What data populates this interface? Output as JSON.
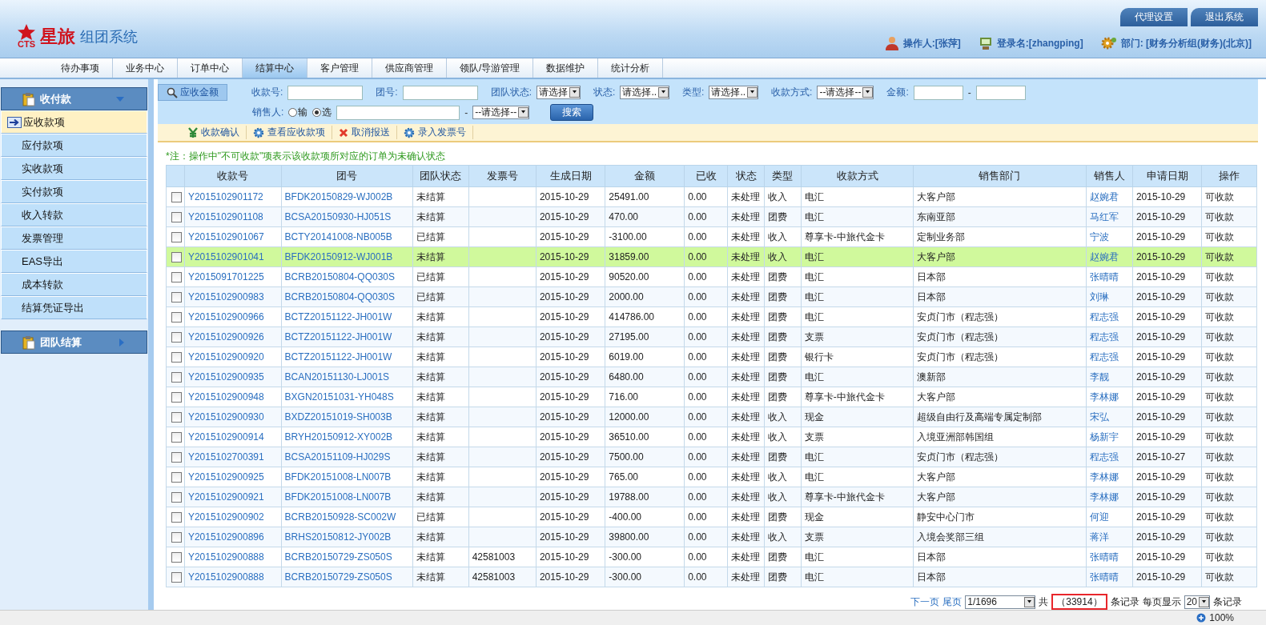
{
  "header": {
    "logo_mark": "CTS",
    "brand": "星旅",
    "system": "组团系统",
    "top_buttons": [
      "代理设置",
      "退出系统"
    ],
    "user_info": [
      {
        "kind": "person",
        "text": "操作人:[张萍]"
      },
      {
        "kind": "login",
        "text": "登录名:[zhangping]"
      },
      {
        "kind": "department",
        "text": "部门: [财务分析组(财务)(北京)]"
      }
    ]
  },
  "nav_tabs": [
    {
      "label": "待办事项",
      "selected": false
    },
    {
      "label": "业务中心",
      "selected": false
    },
    {
      "label": "订单中心",
      "selected": false
    },
    {
      "label": "结算中心",
      "selected": true
    },
    {
      "label": "客户管理",
      "selected": false
    },
    {
      "label": "供应商管理",
      "selected": false
    },
    {
      "label": "领队/导游管理",
      "selected": false
    },
    {
      "label": "数据维护",
      "selected": false
    },
    {
      "label": "统计分析",
      "selected": false
    }
  ],
  "sidebar": {
    "groups": [
      {
        "title": "收付款",
        "expanded": true,
        "items": [
          {
            "label": "应收款项",
            "selected": true
          },
          {
            "label": "应付款项",
            "selected": false
          },
          {
            "label": "实收款项",
            "selected": false
          },
          {
            "label": "实付款项",
            "selected": false
          },
          {
            "label": "收入转款",
            "selected": false
          },
          {
            "label": "发票管理",
            "selected": false
          },
          {
            "label": "EAS导出",
            "selected": false
          },
          {
            "label": "成本转款",
            "selected": false
          },
          {
            "label": "结算凭证导出",
            "selected": false
          }
        ]
      },
      {
        "title": "团队结算",
        "expanded": false
      }
    ]
  },
  "search": {
    "button": "应收金额",
    "fields": [
      {
        "kind": "text",
        "label": "收款号:"
      },
      {
        "kind": "text",
        "label": "团号:"
      },
      {
        "kind": "select",
        "label": "团队状态:",
        "value": "请选择"
      },
      {
        "kind": "select",
        "label": "状态:",
        "value": "请选择.."
      },
      {
        "kind": "select",
        "label": "类型:",
        "value": "请选择.."
      },
      {
        "kind": "select",
        "label": "收款方式:",
        "value": "--请选择--"
      },
      {
        "kind": "range",
        "label": "金额:",
        "separator": "-"
      }
    ],
    "salesperson": {
      "label": "销售人:",
      "options": [
        {
          "label": "输",
          "selected": false
        },
        {
          "label": "选",
          "selected": true
        }
      ],
      "separator": "-",
      "select": "--请选择--"
    },
    "submit": "搜索"
  },
  "toolbar": [
    {
      "kind": "confirm",
      "label": "收款确认"
    },
    {
      "kind": "view",
      "label": "查看应收款项"
    },
    {
      "kind": "cancel",
      "label": "取消报送"
    },
    {
      "kind": "invoice",
      "label": "录入发票号"
    }
  ],
  "note": "*注：操作中\"不可收款\"项表示该收款项所对应的订单为未确认状态",
  "table": {
    "columns": [
      {
        "label": "收款号",
        "kind": "link"
      },
      {
        "label": "团号",
        "kind": "link"
      },
      {
        "label": "团队状态",
        "kind": "text"
      },
      {
        "label": "发票号",
        "kind": "text"
      },
      {
        "label": "生成日期",
        "kind": "text"
      },
      {
        "label": "金额",
        "kind": "text"
      },
      {
        "label": "已收",
        "kind": "text"
      },
      {
        "label": "状态",
        "kind": "text"
      },
      {
        "label": "类型",
        "kind": "text"
      },
      {
        "label": "收款方式",
        "kind": "text"
      },
      {
        "label": "销售部门",
        "kind": "text"
      },
      {
        "label": "销售人",
        "kind": "link"
      },
      {
        "label": "申请日期",
        "kind": "text"
      },
      {
        "label": "操作",
        "kind": "text"
      }
    ],
    "rows": [
      {
        "checked": false,
        "selected": false,
        "cells": [
          "Y2015102901172",
          "BFDK20150829-WJ002B",
          "未结算",
          "",
          "2015-10-29",
          "25491.00",
          "0.00",
          "未处理",
          "收入",
          "电汇",
          "大客户部",
          "赵婉君",
          "2015-10-29",
          "可收款"
        ]
      },
      {
        "checked": false,
        "selected": false,
        "cells": [
          "Y2015102901108",
          "BCSA20150930-HJ051S",
          "未结算",
          "",
          "2015-10-29",
          "470.00",
          "0.00",
          "未处理",
          "团费",
          "电汇",
          "东南亚部",
          "马红军",
          "2015-10-29",
          "可收款"
        ]
      },
      {
        "checked": false,
        "selected": false,
        "cells": [
          "Y2015102901067",
          "BCTY20141008-NB005B",
          "已结算",
          "",
          "2015-10-29",
          "-3100.00",
          "0.00",
          "未处理",
          "收入",
          "尊享卡-中旅代金卡",
          "定制业务部",
          "宁波",
          "2015-10-29",
          "可收款"
        ]
      },
      {
        "checked": false,
        "selected": true,
        "cells": [
          "Y2015102901041",
          "BFDK20150912-WJ001B",
          "未结算",
          "",
          "2015-10-29",
          "31859.00",
          "0.00",
          "未处理",
          "收入",
          "电汇",
          "大客户部",
          "赵婉君",
          "2015-10-29",
          "可收款"
        ]
      },
      {
        "checked": false,
        "selected": false,
        "cells": [
          "Y2015091701225",
          "BCRB20150804-QQ030S",
          "已结算",
          "",
          "2015-10-29",
          "90520.00",
          "0.00",
          "未处理",
          "团费",
          "电汇",
          "日本部",
          "张晴晴",
          "2015-10-29",
          "可收款"
        ]
      },
      {
        "checked": false,
        "selected": false,
        "cells": [
          "Y2015102900983",
          "BCRB20150804-QQ030S",
          "已结算",
          "",
          "2015-10-29",
          "2000.00",
          "0.00",
          "未处理",
          "团费",
          "电汇",
          "日本部",
          "刘琳",
          "2015-10-29",
          "可收款"
        ]
      },
      {
        "checked": false,
        "selected": false,
        "cells": [
          "Y2015102900966",
          "BCTZ20151122-JH001W",
          "未结算",
          "",
          "2015-10-29",
          "414786.00",
          "0.00",
          "未处理",
          "团费",
          "电汇",
          "安贞门市（程志强）",
          "程志强",
          "2015-10-29",
          "可收款"
        ]
      },
      {
        "checked": false,
        "selected": false,
        "cells": [
          "Y2015102900926",
          "BCTZ20151122-JH001W",
          "未结算",
          "",
          "2015-10-29",
          "27195.00",
          "0.00",
          "未处理",
          "团费",
          "支票",
          "安贞门市（程志强）",
          "程志强",
          "2015-10-29",
          "可收款"
        ]
      },
      {
        "checked": false,
        "selected": false,
        "cells": [
          "Y2015102900920",
          "BCTZ20151122-JH001W",
          "未结算",
          "",
          "2015-10-29",
          "6019.00",
          "0.00",
          "未处理",
          "团费",
          "银行卡",
          "安贞门市（程志强）",
          "程志强",
          "2015-10-29",
          "可收款"
        ]
      },
      {
        "checked": false,
        "selected": false,
        "cells": [
          "Y2015102900935",
          "BCAN20151130-LJ001S",
          "未结算",
          "",
          "2015-10-29",
          "6480.00",
          "0.00",
          "未处理",
          "团费",
          "电汇",
          "澳新部",
          "李靓",
          "2015-10-29",
          "可收款"
        ]
      },
      {
        "checked": false,
        "selected": false,
        "cells": [
          "Y2015102900948",
          "BXGN20151031-YH048S",
          "未结算",
          "",
          "2015-10-29",
          "716.00",
          "0.00",
          "未处理",
          "团费",
          "尊享卡-中旅代金卡",
          "大客户部",
          "李林娜",
          "2015-10-29",
          "可收款"
        ]
      },
      {
        "checked": false,
        "selected": false,
        "cells": [
          "Y2015102900930",
          "BXDZ20151019-SH003B",
          "未结算",
          "",
          "2015-10-29",
          "12000.00",
          "0.00",
          "未处理",
          "收入",
          "现金",
          "超级自由行及高端专属定制部",
          "宋弘",
          "2015-10-29",
          "可收款"
        ]
      },
      {
        "checked": false,
        "selected": false,
        "cells": [
          "Y2015102900914",
          "BRYH20150912-XY002B",
          "未结算",
          "",
          "2015-10-29",
          "36510.00",
          "0.00",
          "未处理",
          "收入",
          "支票",
          "入境亚洲部韩国组",
          "杨新宇",
          "2015-10-29",
          "可收款"
        ]
      },
      {
        "checked": false,
        "selected": false,
        "cells": [
          "Y2015102700391",
          "BCSA20151109-HJ029S",
          "未结算",
          "",
          "2015-10-29",
          "7500.00",
          "0.00",
          "未处理",
          "团费",
          "电汇",
          "安贞门市（程志强）",
          "程志强",
          "2015-10-27",
          "可收款"
        ]
      },
      {
        "checked": false,
        "selected": false,
        "cells": [
          "Y2015102900925",
          "BFDK20151008-LN007B",
          "未结算",
          "",
          "2015-10-29",
          "765.00",
          "0.00",
          "未处理",
          "收入",
          "电汇",
          "大客户部",
          "李林娜",
          "2015-10-29",
          "可收款"
        ]
      },
      {
        "checked": false,
        "selected": false,
        "cells": [
          "Y2015102900921",
          "BFDK20151008-LN007B",
          "未结算",
          "",
          "2015-10-29",
          "19788.00",
          "0.00",
          "未处理",
          "收入",
          "尊享卡-中旅代金卡",
          "大客户部",
          "李林娜",
          "2015-10-29",
          "可收款"
        ]
      },
      {
        "checked": false,
        "selected": false,
        "cells": [
          "Y2015102900902",
          "BCRB20150928-SC002W",
          "已结算",
          "",
          "2015-10-29",
          "-400.00",
          "0.00",
          "未处理",
          "团费",
          "现金",
          "静安中心门市",
          "何迎",
          "2015-10-29",
          "可收款"
        ]
      },
      {
        "checked": false,
        "selected": false,
        "cells": [
          "Y2015102900896",
          "BRHS20150812-JY002B",
          "未结算",
          "",
          "2015-10-29",
          "39800.00",
          "0.00",
          "未处理",
          "收入",
          "支票",
          "入境会奖部三组",
          "蒋洋",
          "2015-10-29",
          "可收款"
        ]
      },
      {
        "checked": false,
        "selected": false,
        "cells": [
          "Y2015102900888",
          "BCRB20150729-ZS050S",
          "未结算",
          "42581003",
          "2015-10-29",
          "-300.00",
          "0.00",
          "未处理",
          "团费",
          "电汇",
          "日本部",
          "张晴晴",
          "2015-10-29",
          "可收款"
        ]
      },
      {
        "checked": false,
        "selected": false,
        "cells": [
          "Y2015102900888",
          "BCRB20150729-ZS050S",
          "未结算",
          "42581003",
          "2015-10-29",
          "-300.00",
          "0.00",
          "未处理",
          "团费",
          "电汇",
          "日本部",
          "张晴晴",
          "2015-10-29",
          "可收款"
        ]
      }
    ]
  },
  "pager": {
    "next": "下一页",
    "last": "尾页",
    "page": "1/1696",
    "total_prefix": "共",
    "total": "（33914）",
    "total_highlighted": true,
    "total_suffix": "条记录",
    "per_page_label": "每页显示",
    "per_page": "20",
    "per_page_suffix": "条记录"
  },
  "status_bar": {
    "zoom": "100%"
  }
}
